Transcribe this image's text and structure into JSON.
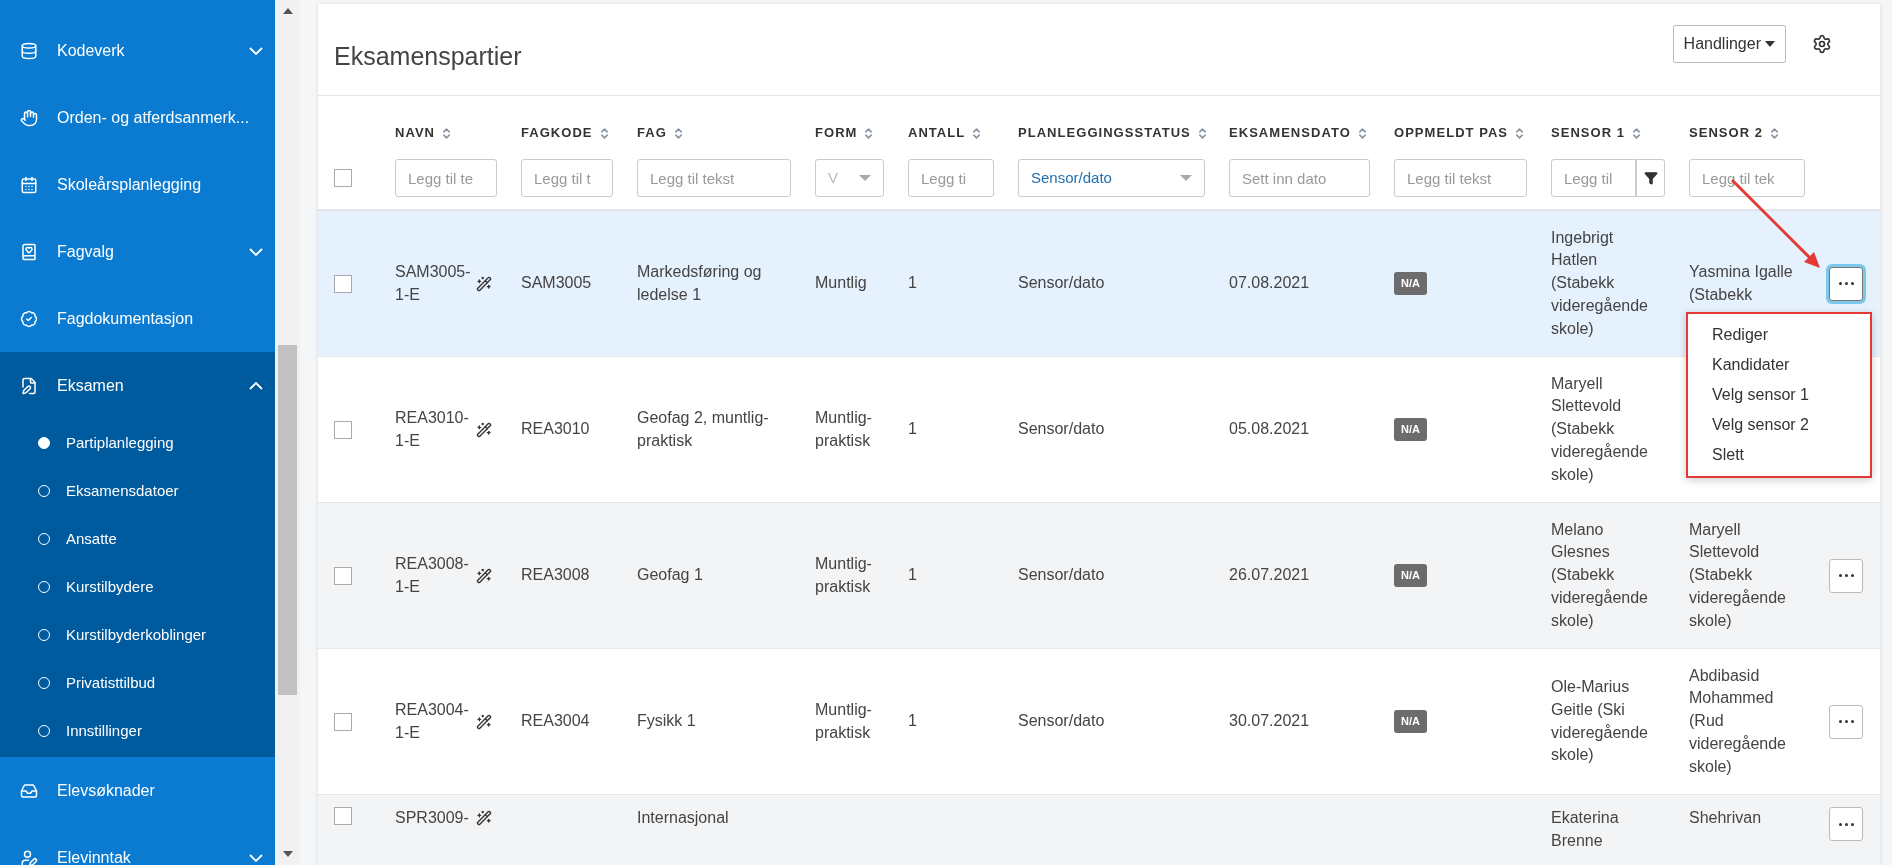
{
  "sidebar": {
    "items": [
      {
        "label": "Kodeverk",
        "expanded": false
      },
      {
        "label": "Orden- og atferdsanmerk..."
      },
      {
        "label": "Skoleårsplanlegging"
      },
      {
        "label": "Fagvalg",
        "expanded": false
      },
      {
        "label": "Fagdokumentasjon"
      },
      {
        "label": "Eksamen",
        "expanded": true,
        "children": [
          {
            "label": "Partiplanlegging",
            "selected": true
          },
          {
            "label": "Eksamensdatoer",
            "selected": false
          },
          {
            "label": "Ansatte",
            "selected": false
          },
          {
            "label": "Kurstilbydere",
            "selected": false
          },
          {
            "label": "Kurstilbyderkoblinger",
            "selected": false
          },
          {
            "label": "Privatisttilbud",
            "selected": false
          },
          {
            "label": "Innstillinger",
            "selected": false
          }
        ]
      },
      {
        "label": "Elevsøknader"
      },
      {
        "label": "Elevinntak",
        "expanded": false
      }
    ]
  },
  "card": {
    "title": "Eksamenspartier",
    "actions_button": "Handlinger"
  },
  "table": {
    "columns": [
      {
        "label": "NAVN",
        "filter": {
          "kind": "text",
          "placeholder": "Legg til te"
        }
      },
      {
        "label": "FAGKODE",
        "filter": {
          "kind": "text",
          "placeholder": "Legg til t"
        }
      },
      {
        "label": "FAG",
        "filter": {
          "kind": "text",
          "placeholder": "Legg til tekst"
        }
      },
      {
        "label": "FORM",
        "filter": {
          "kind": "select",
          "value": "V",
          "muted": true
        }
      },
      {
        "label": "ANTALL",
        "filter": {
          "kind": "text",
          "placeholder": "Legg ti"
        }
      },
      {
        "label": "PLANLEGGINGSSTATUS",
        "filter": {
          "kind": "select",
          "value": "Sensor/dato",
          "muted": false
        }
      },
      {
        "label": "EKSAMENSDATO",
        "filter": {
          "kind": "text",
          "placeholder": "Sett inn dato"
        }
      },
      {
        "label": "OPPMELDT PAS",
        "filter": {
          "kind": "text",
          "placeholder": "Legg til tekst"
        }
      },
      {
        "label": "SENSOR 1",
        "filter": {
          "kind": "text_with_button",
          "placeholder": "Legg til"
        }
      },
      {
        "label": "SENSOR 2",
        "filter": {
          "kind": "text",
          "placeholder": "Legg til tek"
        }
      }
    ],
    "select_all_checked": false,
    "rows": [
      {
        "selected": true,
        "checked": false,
        "menu_open": true,
        "cells": [
          "SAM3005-1-E",
          "SAM3005",
          "Markedsføring og ledelse 1",
          "Muntlig",
          "1",
          "Sensor/dato",
          "07.08.2021",
          "N/A",
          "Ingebrigt Hatlen (Stabekk videregående skole)",
          "Yasmina Igalle (Stabekk"
        ]
      },
      {
        "selected": false,
        "checked": false,
        "menu_open": false,
        "cells": [
          "REA3010-1-E",
          "REA3010",
          "Geofag 2, muntlig-praktisk",
          "Muntlig-praktisk",
          "1",
          "Sensor/dato",
          "05.08.2021",
          "N/A",
          "Maryell Slettevold (Stabekk videregående skole)",
          null
        ]
      },
      {
        "selected": false,
        "checked": false,
        "menu_open": false,
        "cells": [
          "REA3008-1-E",
          "REA3008",
          "Geofag 1",
          "Muntlig-praktisk",
          "1",
          "Sensor/dato",
          "26.07.2021",
          "N/A",
          "Melano Glesnes (Stabekk videregående skole)",
          "Maryell Slettevold (Stabekk videregående skole)"
        ]
      },
      {
        "selected": false,
        "checked": false,
        "menu_open": false,
        "cells": [
          "REA3004-1-E",
          "REA3004",
          "Fysikk 1",
          "Muntlig-praktisk",
          "1",
          "Sensor/dato",
          "30.07.2021",
          "N/A",
          "Ole-Marius Geitle (Ski videregående skole)",
          "Abdibasid Mohammed (Rud videregående skole)"
        ]
      },
      {
        "selected": false,
        "checked": false,
        "menu_open": false,
        "cells": [
          "SPR3009-",
          null,
          "Internasjonal",
          null,
          null,
          null,
          null,
          null,
          "Ekaterina Brenne",
          "Shehrivan"
        ]
      }
    ]
  },
  "row_menu": {
    "items": [
      "Rediger",
      "Kandidater",
      "Velg sensor 1",
      "Velg sensor 2",
      "Slett"
    ]
  }
}
